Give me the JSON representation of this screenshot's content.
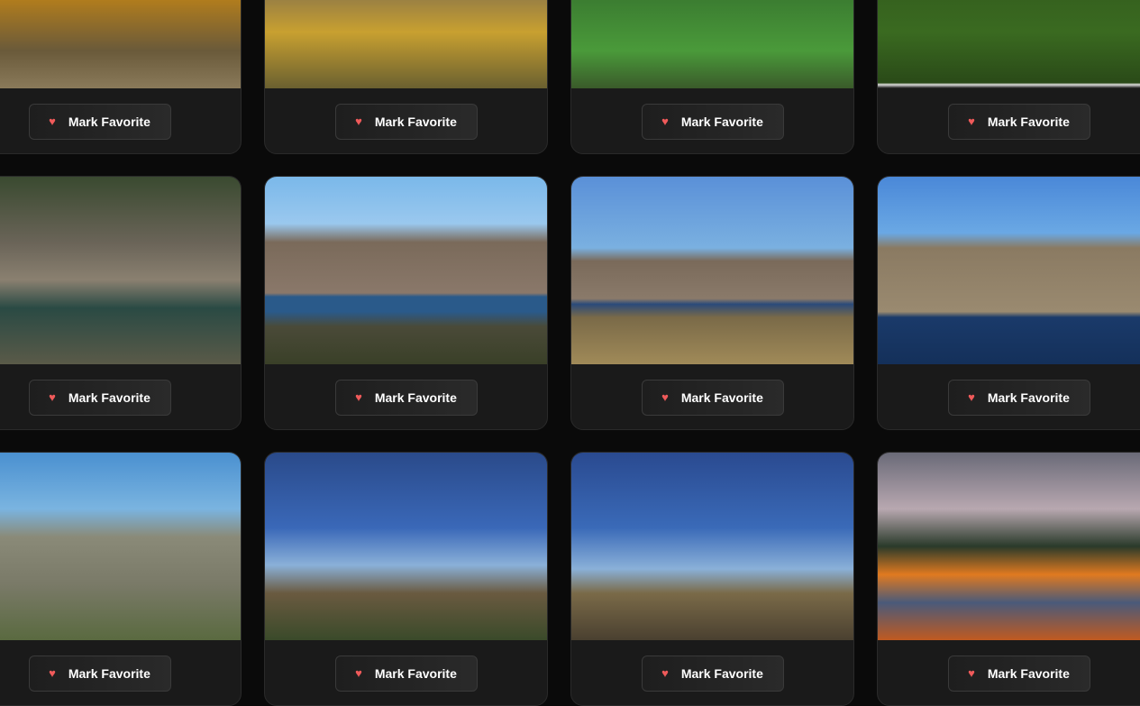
{
  "button_label": "Mark Favorite",
  "button_icon": "heart-icon",
  "accent_heart": "#f05a5a",
  "cards": [
    {
      "photo": "linear-gradient(180deg,#d8a020 0%,#b8801a 50%,#6a5a3a 80%,#8a7a5a 100%)"
    },
    {
      "photo": "linear-gradient(180deg,#5a5248 0%,#7a6a50 40%,#c8a030 70%,#6a6030 100%)"
    },
    {
      "photo": "linear-gradient(180deg,#1e3a1e 0%,#3a7a30 50%,#4a9a3a 80%,#3a5a2a 100%)"
    },
    {
      "photo": "linear-gradient(180deg,#2a4a1a 0%,#3a6a20 70%,#2a4a18 97%,#ddd 98%,#111 100%)"
    },
    {
      "photo": "linear-gradient(180deg,#3a4a30 0%,#6a6458 35%,#8a8070 55%,#2a4a44 70%,#5a5a48 100%)"
    },
    {
      "photo": "linear-gradient(180deg,#7ab8ea 0%,#9ac8ee 25%,#7a6a5a 35%,#8a786a 62%,#2a5a8a 64%,#2a5a8a 72%,#4a4a38 80%,#3a4028 100%)"
    },
    {
      "photo": "linear-gradient(180deg,#5a90d8 0%,#7ab0e0 38%,#7a6a5a 45%,#8a7a6a 65%,#2a4a7a 68%,#7a6a48 75%,#a08a58 100%)"
    },
    {
      "photo": "linear-gradient(180deg,#4a88d8 0%,#6aa8e4 30%,#8a7a62 38%,#9a8a70 72%,#1a3a6a 75%,#14305a 100%)"
    },
    {
      "photo": "linear-gradient(180deg,#4a90d0 0%,#7ab4e0 30%,#8a8a78 45%,#7a7a68 70%,#5a6a40 100%)"
    },
    {
      "photo": "linear-gradient(180deg,#2a4a8a 0%,#3a68b8 40%,#8ab0d8 60%,#6a5a40 75%,#3a4a2a 100%)"
    },
    {
      "photo": "linear-gradient(180deg,#2a4a90 0%,#3a6ab8 40%,#8ab0d8 62%,#7a6a48 75%,#4a4030 100%)"
    },
    {
      "photo": "linear-gradient(180deg,#6a6a78 0%,#b8a8b0 30%,#2a3a2a 50%,#e07a20 65%,#4a5a7a 80%,#c05a20 100%)"
    }
  ]
}
